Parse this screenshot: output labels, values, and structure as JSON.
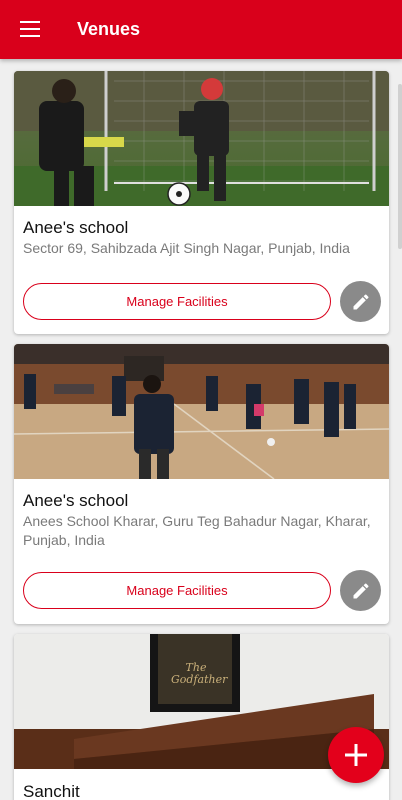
{
  "appbar": {
    "title": "Venues",
    "menu_icon": "hamburger-menu-icon"
  },
  "venues": [
    {
      "name": "Anee's school",
      "address": "Sector 69, Sahibzada Ajit Singh Nagar, Punjab, India",
      "manage_label": "Manage Facilities",
      "photo": "outdoor football goalkeeper"
    },
    {
      "name": "Anee's school",
      "address": "Anees School Kharar, Guru Teg Bahadur Nagar, Kharar, Punjab, India",
      "manage_label": "Manage Facilities",
      "photo": "indoor futsal court"
    },
    {
      "name": "Sanchit",
      "address": "",
      "manage_label": "",
      "photo": "room with framed poster"
    }
  ],
  "poster_text": "The Godfather",
  "fab": {
    "icon": "plus-icon"
  },
  "colors": {
    "primary": "#d9001b",
    "edit_button": "#8a8a8a"
  }
}
